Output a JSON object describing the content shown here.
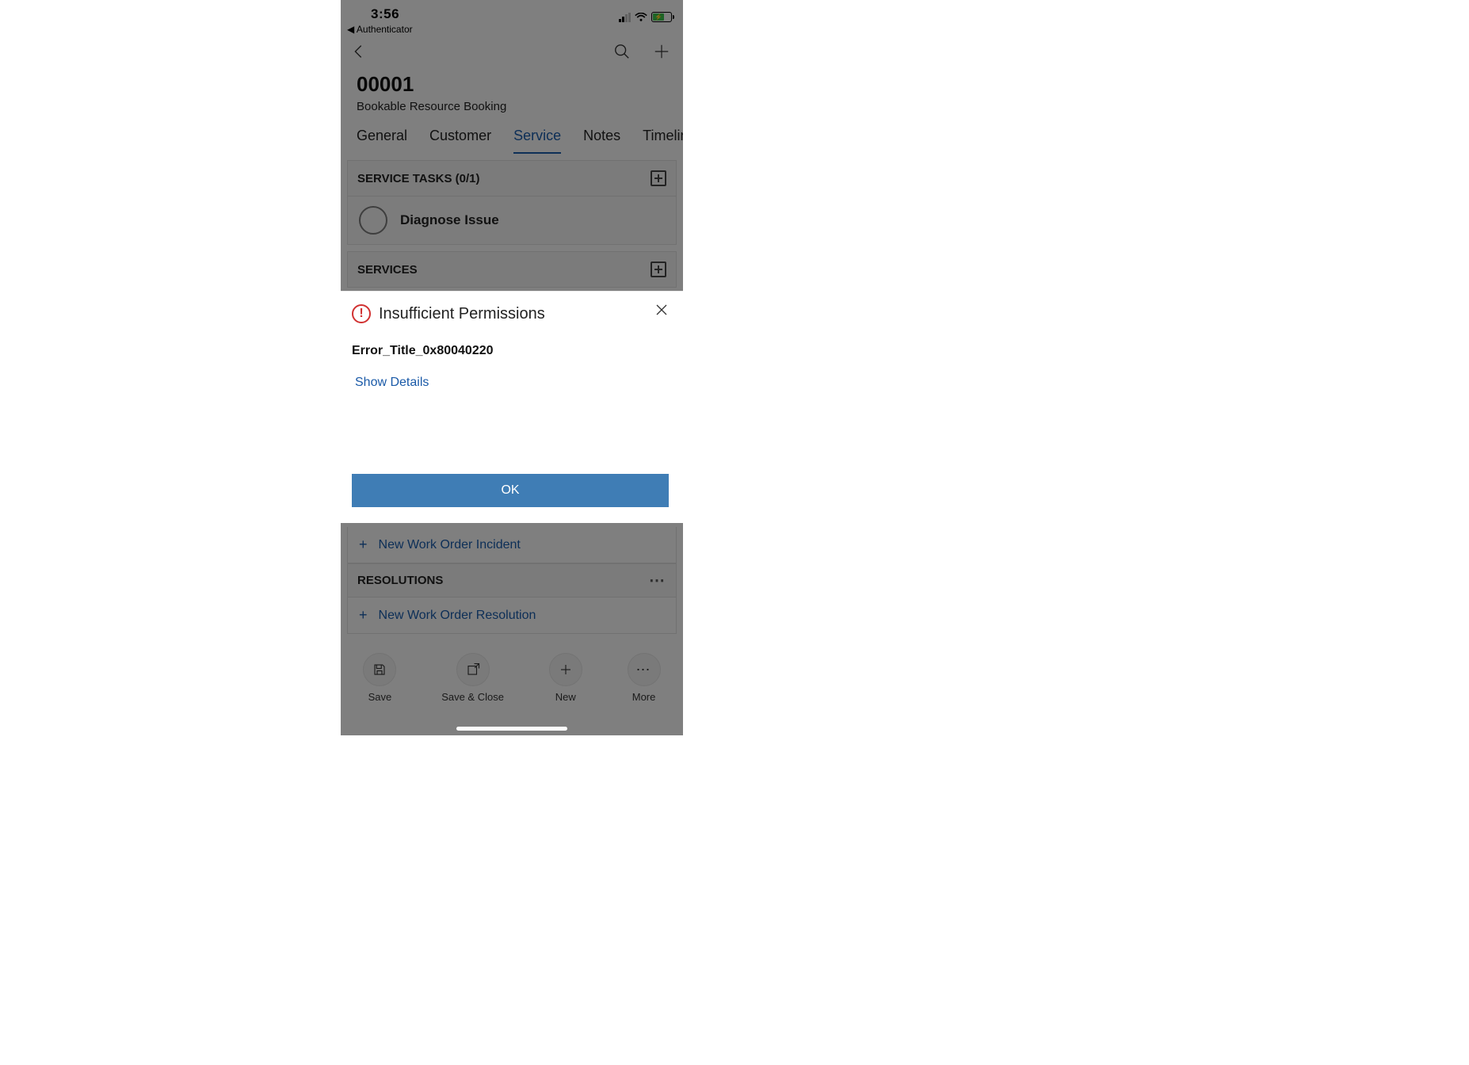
{
  "statusbar": {
    "time": "3:56",
    "back_app": "◀ Authenticator"
  },
  "header": {
    "record_id": "00001",
    "entity": "Bookable Resource Booking"
  },
  "tabs": {
    "items": [
      "General",
      "Customer",
      "Service",
      "Notes",
      "Timeline"
    ],
    "active_index": 2
  },
  "sections": {
    "service_tasks": {
      "title": "SERVICE TASKS (0/1)",
      "items": [
        {
          "label": "Diagnose Issue",
          "completed": false
        }
      ]
    },
    "services": {
      "title": "SERVICES"
    },
    "incidents": {
      "link_label": "New Work Order Incident"
    },
    "resolutions": {
      "title": "RESOLUTIONS",
      "link_label": "New Work Order Resolution"
    }
  },
  "bottom_bar": {
    "items": [
      {
        "label": "Save",
        "icon": "save-icon"
      },
      {
        "label": "Save & Close",
        "icon": "save-close-icon"
      },
      {
        "label": "New",
        "icon": "plus-icon"
      },
      {
        "label": "More",
        "icon": "more-icon"
      }
    ]
  },
  "modal": {
    "title": "Insufficient Permissions",
    "error_code": "Error_Title_0x80040220",
    "show_details": "Show Details",
    "ok": "OK"
  }
}
